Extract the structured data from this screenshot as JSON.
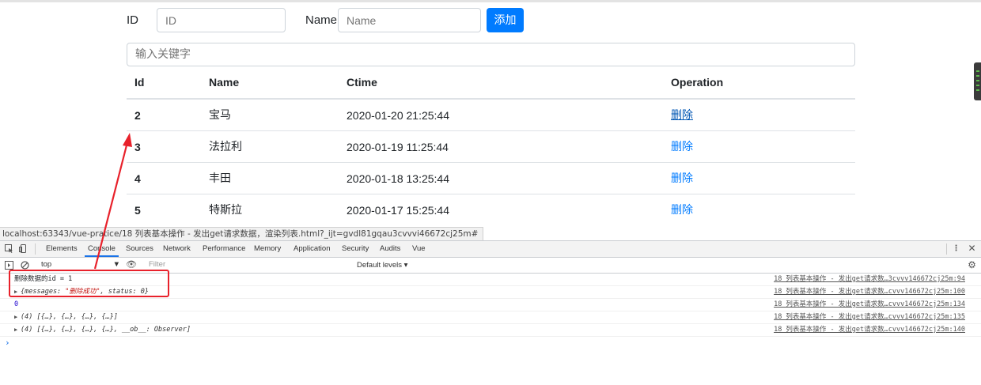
{
  "form": {
    "id_label": "ID",
    "id_placeholder": "ID",
    "name_label": "Name",
    "name_placeholder": "Name",
    "add_button": "添加"
  },
  "search": {
    "placeholder": "输入关键字"
  },
  "table": {
    "headers": [
      "Id",
      "Name",
      "Ctime",
      "Operation"
    ],
    "rows": [
      {
        "id": "2",
        "name": "宝马",
        "ctime": "2020-01-20 21:25:44",
        "op": "删除"
      },
      {
        "id": "3",
        "name": "法拉利",
        "ctime": "2020-01-19 11:25:44",
        "op": "删除"
      },
      {
        "id": "4",
        "name": "丰田",
        "ctime": "2020-01-18 13:25:44",
        "op": "删除"
      },
      {
        "id": "5",
        "name": "特斯拉",
        "ctime": "2020-01-17 15:25:44",
        "op": "删除"
      }
    ]
  },
  "status_url": "localhost:63343/vue-pratice/18 列表基本操作 - 发出get请求数据，渲染列表.html?_ijt=gvdl81gqau3cvvvi46672cj25m#",
  "devtools": {
    "tabs": [
      "Elements",
      "Console",
      "Sources",
      "Network",
      "Performance",
      "Memory",
      "Application",
      "Security",
      "Audits",
      "Vue"
    ],
    "context": "top",
    "filter_placeholder": "Filter",
    "levels": "Default levels ▾",
    "logs": [
      {
        "text": "删除数据的id = 1",
        "source": "18 列表基本操作 - 发出get请求数…3cvvv146672cj25m:94"
      },
      {
        "prefix": "{messages: ",
        "str": "\"删除成功\"",
        "suffix": ", status: 0}",
        "source": "18 列表基本操作 - 发出get请求数…cvvv146672cj25m:100"
      },
      {
        "text": "0",
        "source": "18 列表基本操作 - 发出get请求数…cvvv146672cj25m:134"
      },
      {
        "text": "(4) [{…}, {…}, {…}, {…}]",
        "source": "18 列表基本操作 - 发出get请求数…cvvv146672cj25m:135"
      },
      {
        "text": "(4) [{…}, {…}, {…}, {…}, __ob__: Observer]",
        "source": "18 列表基本操作 - 发出get请求数…cvvv146672cj25m:140"
      }
    ]
  },
  "colors": {
    "primary": "#007bff",
    "annotation": "#e8212b"
  }
}
